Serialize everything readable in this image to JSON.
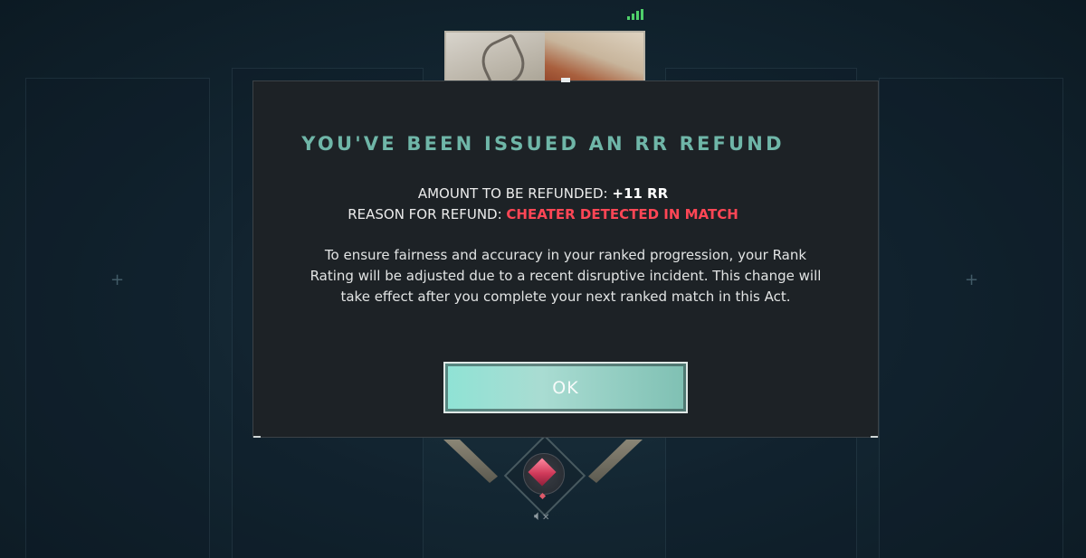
{
  "modal": {
    "title": "YOU'VE BEEN ISSUED AN RR REFUND",
    "amount_label": "AMOUNT TO BE REFUNDED:",
    "amount_value": "+11 RR",
    "reason_label": "REASON FOR REFUND:",
    "reason_value": "CHEATER DETECTED IN MATCH",
    "description": "To ensure fairness and accuracy in your ranked progression, your Rank Rating will be adjusted due to a recent disruptive incident. This change will take effect after you complete your next ranked match in this Act.",
    "ok_label": "OK"
  },
  "icons": {
    "network": "signal-bars-icon",
    "mute": "speaker-muted-icon",
    "rank": "rank-gem-icon"
  },
  "colors": {
    "title": "#6fb6a8",
    "reason": "#ff4655",
    "button": "#8fe3d5",
    "signal": "#4fcf6a"
  }
}
